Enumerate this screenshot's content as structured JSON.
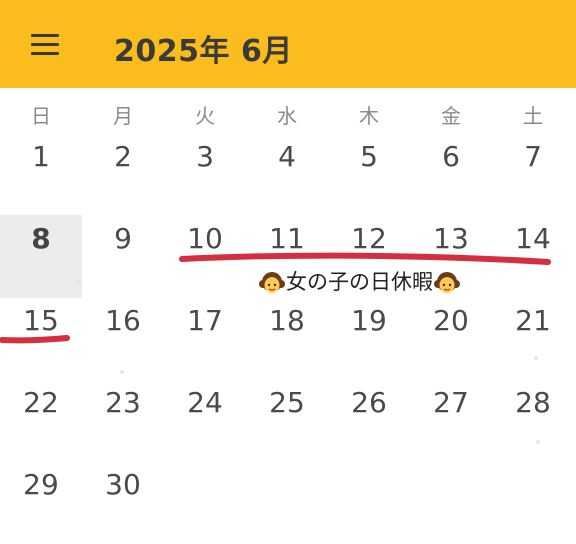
{
  "header": {
    "title": "2025年 6月",
    "menu_icon": "hamburger-menu-icon",
    "background_color": "#fbbd1e"
  },
  "weekdays": [
    "日",
    "月",
    "火",
    "水",
    "木",
    "金",
    "土"
  ],
  "weeks": [
    [
      "1",
      "2",
      "3",
      "4",
      "5",
      "6",
      "7"
    ],
    [
      "8",
      "9",
      "10",
      "11",
      "12",
      "13",
      "14"
    ],
    [
      "15",
      "16",
      "17",
      "18",
      "19",
      "20",
      "21"
    ],
    [
      "22",
      "23",
      "24",
      "25",
      "26",
      "27",
      "28"
    ],
    [
      "29",
      "30",
      "",
      "",
      "",
      "",
      ""
    ]
  ],
  "today": "8",
  "event": {
    "label": "女の子の日休暇",
    "icon": "girl-emoji-icon",
    "underline_color": "#d32f3f"
  }
}
